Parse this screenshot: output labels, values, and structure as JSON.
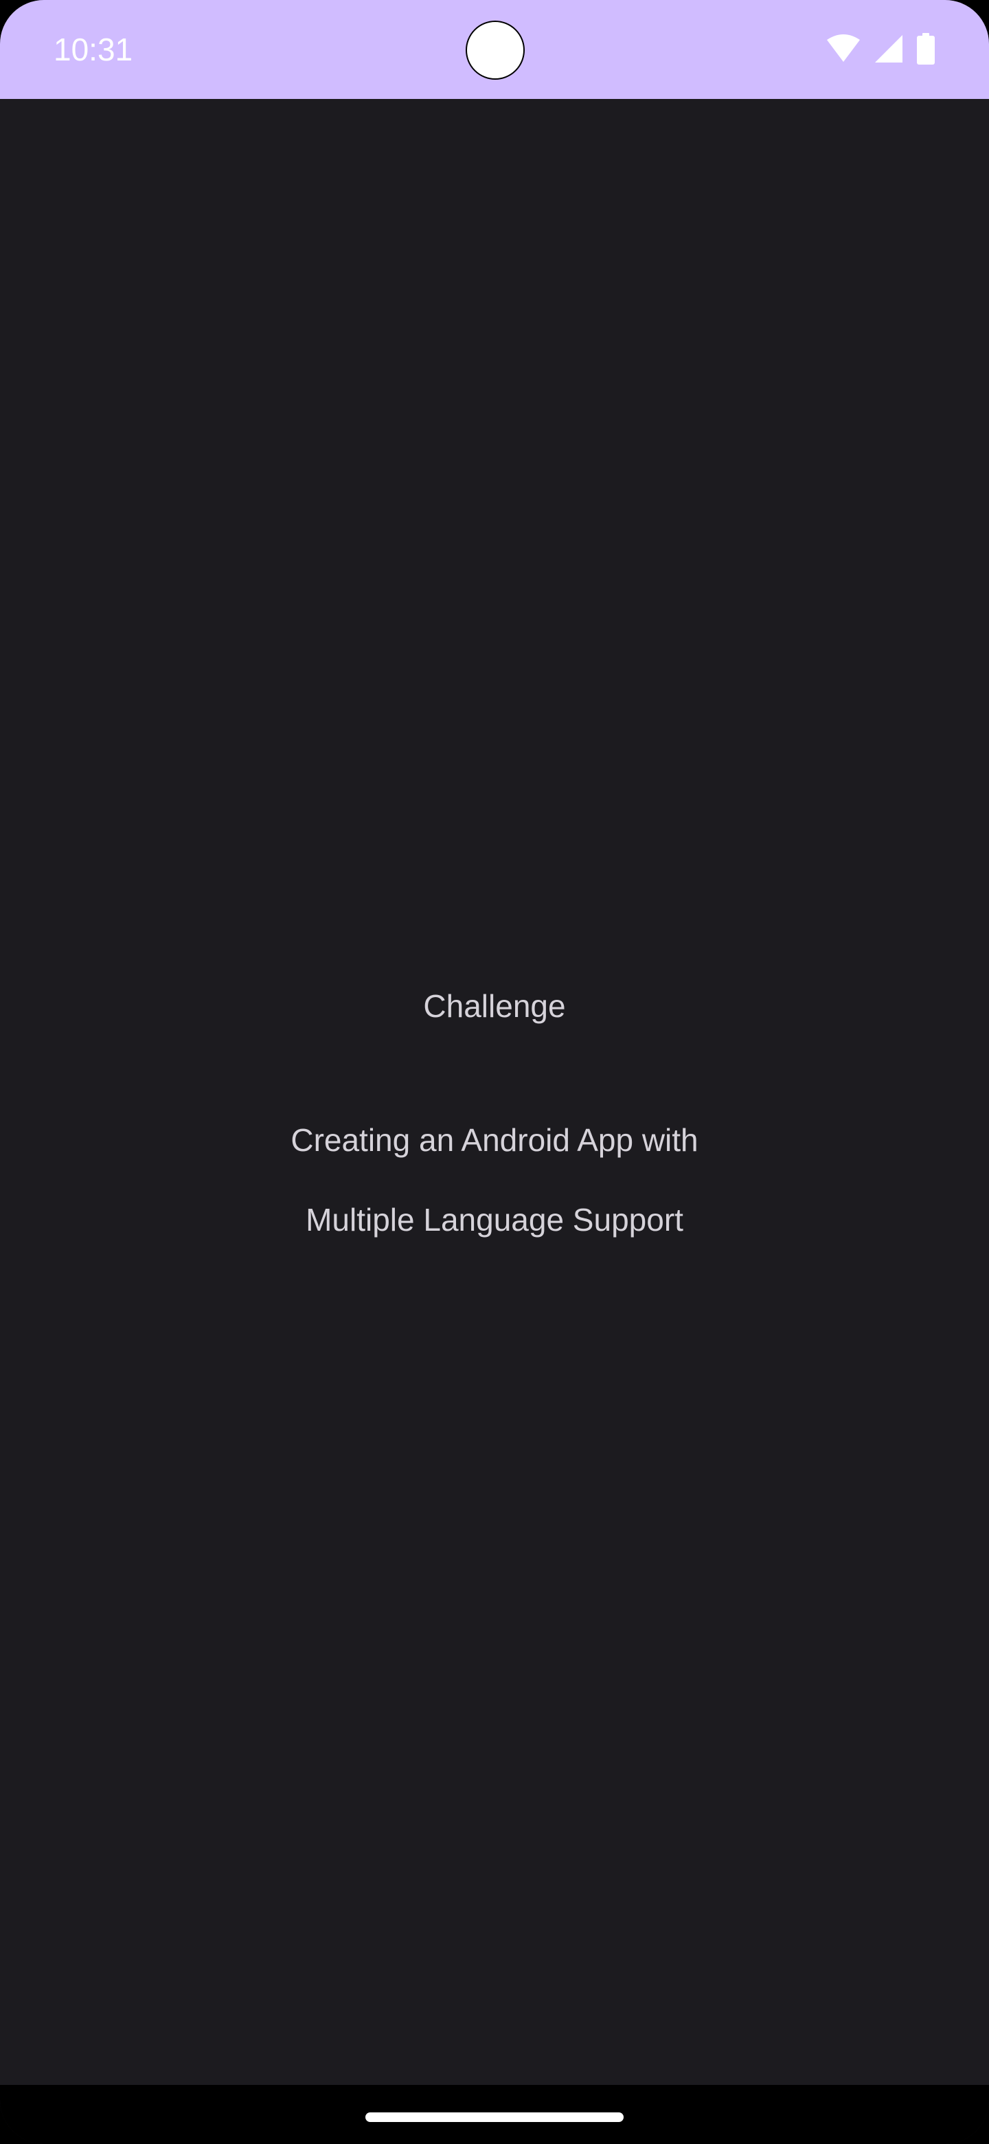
{
  "status_bar": {
    "time": "10:31",
    "background_color": "#d0bcff",
    "icons": [
      "wifi-icon",
      "cellular-signal-icon",
      "battery-icon"
    ]
  },
  "main": {
    "label": "Challenge",
    "description_lines": [
      "Creating an Android App with",
      "Multiple Language Support"
    ],
    "background_color": "#1c1b1f",
    "text_color": "#d6d3da"
  },
  "navigation_bar": {
    "type": "gesture-navigation",
    "background_color": "#000000"
  }
}
